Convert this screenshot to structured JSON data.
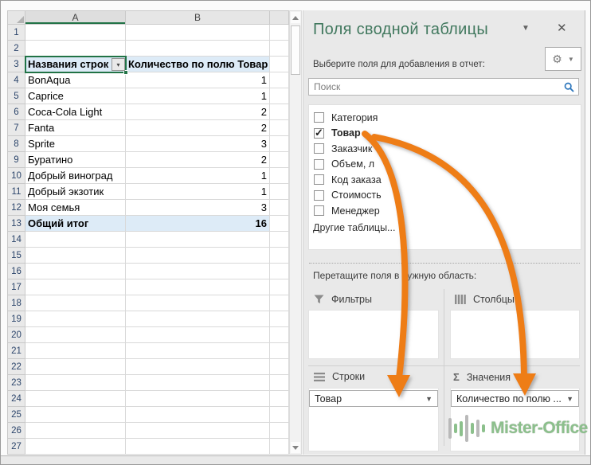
{
  "spreadsheet": {
    "col_headers": [
      "A",
      "B"
    ],
    "total_rows": 27,
    "cells": {
      "3": {
        "a": "Названия строк",
        "b": "Количество по полю Товар",
        "header": true
      },
      "4": {
        "a": "BonAqua",
        "b": "1"
      },
      "5": {
        "a": "Caprice",
        "b": "1"
      },
      "6": {
        "a": "Coca-Cola Light",
        "b": "2"
      },
      "7": {
        "a": "Fanta",
        "b": "2"
      },
      "8": {
        "a": "Sprite",
        "b": "3"
      },
      "9": {
        "a": "Буратино",
        "b": "2"
      },
      "10": {
        "a": "Добрый виноград",
        "b": "1"
      },
      "11": {
        "a": "Добрый экзотик",
        "b": "1"
      },
      "12": {
        "a": "Моя семья",
        "b": "3"
      },
      "13": {
        "a": "Общий итог",
        "b": "16",
        "total": true
      }
    },
    "filter_chevron": "▾"
  },
  "panel": {
    "title": "Поля сводной таблицы",
    "chevron": "▼",
    "close": "✕",
    "subtitle": "Выберите поля для добавления в отчет:",
    "gear": "⚙",
    "gear_chevron": "▼",
    "search_placeholder": "Поиск",
    "fields": [
      {
        "label": "Категория",
        "checked": false
      },
      {
        "label": "Товар",
        "checked": true
      },
      {
        "label": "Заказчик",
        "checked": false
      },
      {
        "label": "Объем, л",
        "checked": false
      },
      {
        "label": "Код заказа",
        "checked": false
      },
      {
        "label": "Стоимость",
        "checked": false
      },
      {
        "label": "Менеджер",
        "checked": false
      }
    ],
    "more_tables_link": "Другие таблицы...",
    "drag_hint": "Перетащите поля в нужную область:",
    "areas": {
      "filters_label": "Фильтры",
      "columns_label": "Столбцы",
      "rows_label": "Строки",
      "values_label": "Значения",
      "sigma": "Σ",
      "rows_item": "Товар",
      "values_item": "Количество по полю ...",
      "dropdown_chevron": "▼"
    }
  },
  "watermark": {
    "text": "Mister-Office"
  },
  "colors": {
    "selection_green": "#217346",
    "title_green": "#41785e",
    "pivot_header_blue": "#ddebf7",
    "arrow_orange": "#ee7d19",
    "logo_green": "#8cc08c"
  }
}
